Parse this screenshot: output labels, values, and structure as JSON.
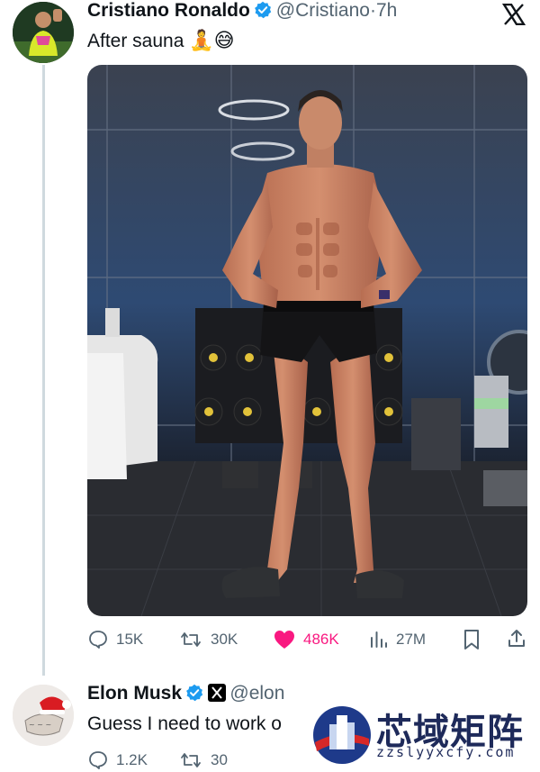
{
  "tweet": {
    "author_name": "Cristiano Ronaldo",
    "handle": "@Cristiano",
    "separator": "·",
    "time": "7h",
    "text": "After sauna",
    "emojis": "🧘😅",
    "image_alt_icon": "photo",
    "stats": {
      "replies": "15K",
      "retweets": "30K",
      "likes": "486K",
      "views": "27M"
    }
  },
  "reply": {
    "author_name": "Elon Musk",
    "handle": "@elon",
    "text": "Guess I need to work o",
    "stats": {
      "replies": "1.2K",
      "retweets": "30"
    }
  },
  "watermark": {
    "brand_cn": "芯域矩阵",
    "brand_url": "zzslyyxcfy.com"
  },
  "colors": {
    "verified_blue": "#1d9bf0",
    "like_pink": "#f91880",
    "muted": "#536471"
  }
}
